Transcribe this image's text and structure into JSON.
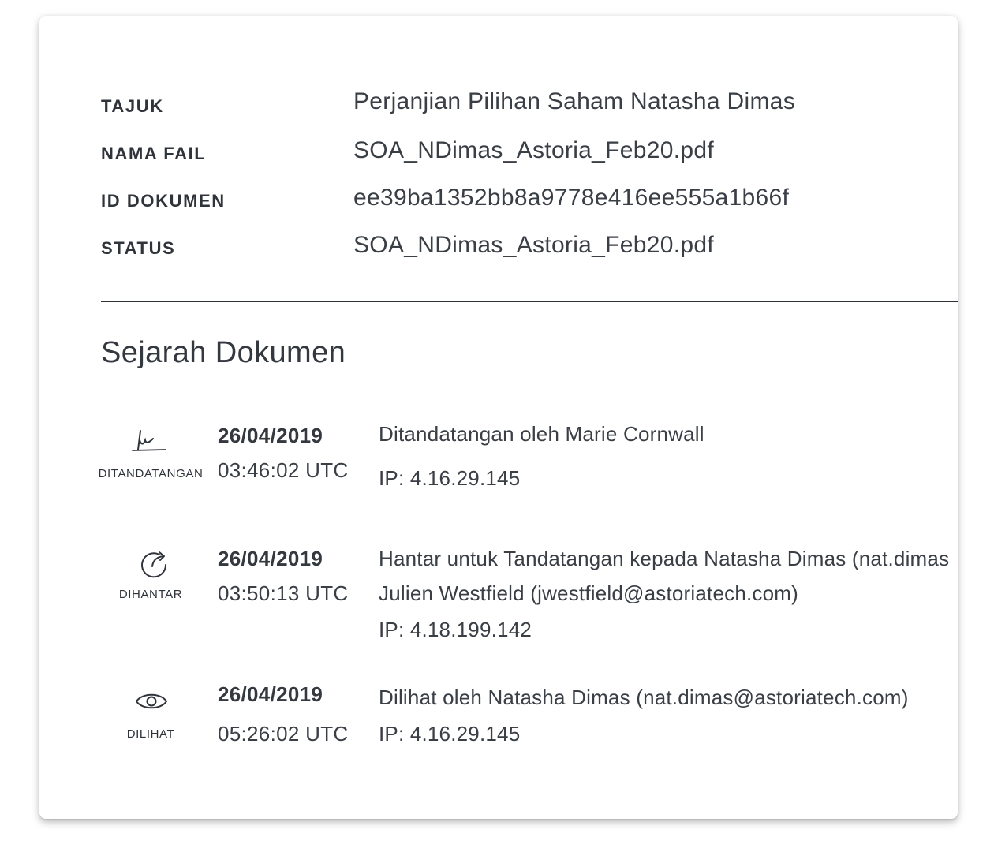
{
  "details": [
    {
      "label": "TAJUK",
      "value": "Perjanjian Pilihan Saham Natasha Dimas"
    },
    {
      "label": "NAMA FAIL",
      "value": "SOA_NDimas_Astoria_Feb20.pdf"
    },
    {
      "label": "ID DOKUMEN",
      "value": "ee39ba1352bb8a9778e416ee555a1b66f"
    },
    {
      "label": "STATUS",
      "value": "SOA_NDimas_Astoria_Feb20.pdf"
    }
  ],
  "history": {
    "title": "Sejarah Dokumen",
    "events": [
      {
        "icon": "signature-icon",
        "type": "DITANDATANGAN",
        "date": "26/04/2019",
        "time": "03:46:02 UTC",
        "lines": [
          "Ditandatangan oleh Marie Cornwall",
          "IP: 4.16.29.145"
        ]
      },
      {
        "icon": "send-arrow-icon",
        "type": "DIHANTAR",
        "date": "26/04/2019",
        "time": "03:50:13 UTC",
        "lines": [
          "Hantar untuk Tandatangan kepada Natasha Dimas (nat.dimas",
          "Julien Westfield (jwestfield@astoriatech.com)",
          "IP: 4.18.199.142"
        ]
      },
      {
        "icon": "eye-icon",
        "type": "DILIHAT",
        "date": "26/04/2019",
        "time": "05:26:02 UTC",
        "lines": [
          "Dilihat oleh Natasha Dimas (nat.dimas@astoriatech.com)",
          "IP: 4.16.29.145"
        ]
      }
    ]
  }
}
